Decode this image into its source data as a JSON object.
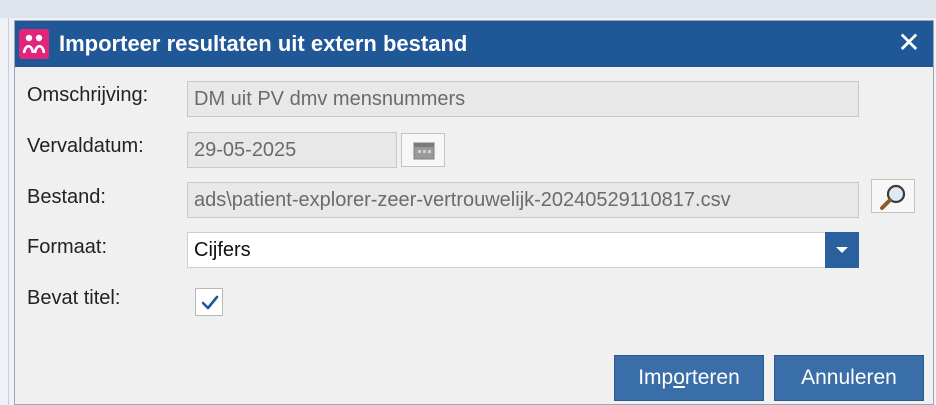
{
  "dialog": {
    "title": "Importeer resultaten uit extern bestand",
    "close_label": "✕",
    "app_icon": "app-logo-icon",
    "accent_color": "#1f5797"
  },
  "form": {
    "description": {
      "label": "Omschrijving:",
      "value": "DM uit PV dmv mensnummers"
    },
    "expiry": {
      "label": "Vervaldatum:",
      "value": "29-05-2025",
      "button_icon": "calendar-icon"
    },
    "file": {
      "label": "Bestand:",
      "value": "ads\\patient-explorer-zeer-vertrouwelijk-20240529110817.csv",
      "button_icon": "search-icon"
    },
    "format": {
      "label": "Formaat:",
      "value": "Cijfers",
      "button_icon": "chevron-down-icon"
    },
    "has_title": {
      "label": "Bevat titel:",
      "checked": true
    }
  },
  "buttons": {
    "import_pre": "Imp",
    "import_accel": "o",
    "import_post": "rteren",
    "cancel": "Annuleren"
  }
}
